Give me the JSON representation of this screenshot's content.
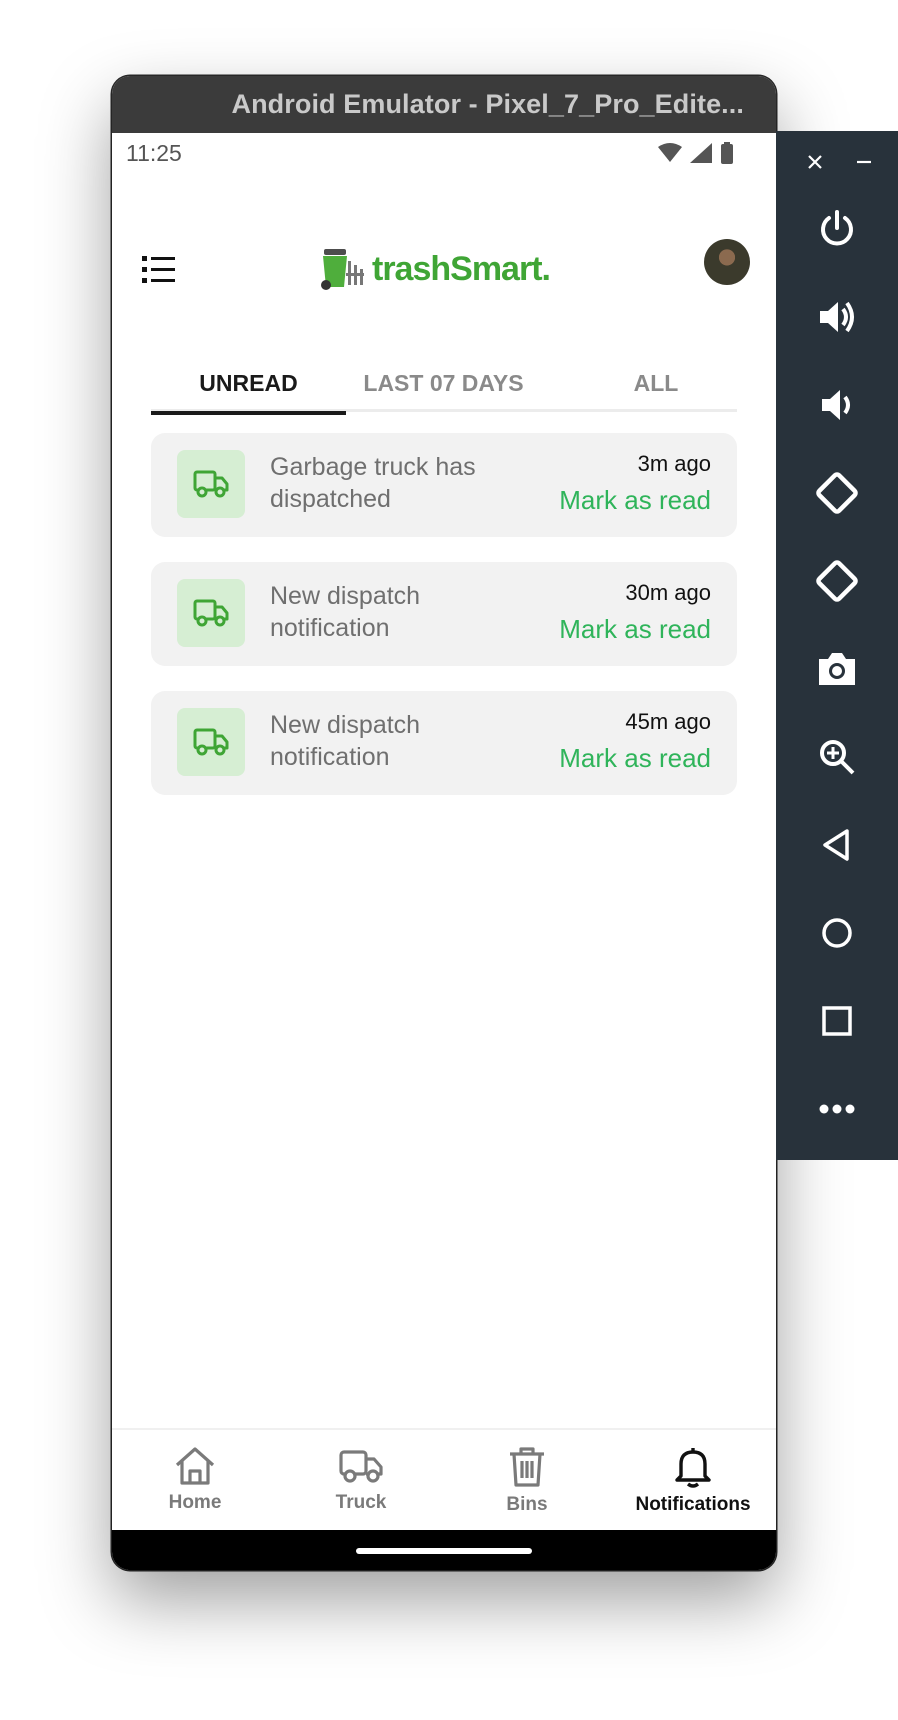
{
  "window": {
    "title": "Android Emulator - Pixel_7_Pro_Edite..."
  },
  "status_bar": {
    "time": "11:25",
    "icons": [
      "wifi-icon",
      "cell-signal-icon",
      "battery-icon"
    ]
  },
  "header": {
    "menu_icon": "list-menu-icon",
    "logo_text": "trashSmart.",
    "avatar": "user-avatar"
  },
  "tabs": [
    {
      "label": "UNREAD",
      "active": true
    },
    {
      "label": "LAST 07 DAYS",
      "active": false
    },
    {
      "label": "ALL",
      "active": false
    }
  ],
  "notifications": [
    {
      "title": "Garbage truck has dispatched",
      "time": "3m ago",
      "action": "Mark as read",
      "icon": "truck-icon"
    },
    {
      "title": "New dispatch notification",
      "time": "30m ago",
      "action": "Mark as read",
      "icon": "truck-icon"
    },
    {
      "title": "New dispatch notification",
      "time": "45m ago",
      "action": "Mark as read",
      "icon": "truck-icon"
    }
  ],
  "bottom_nav": [
    {
      "label": "Home",
      "icon": "home-icon",
      "active": false
    },
    {
      "label": "Truck",
      "icon": "truck-icon",
      "active": false
    },
    {
      "label": "Bins",
      "icon": "trash-bin-icon",
      "active": false
    },
    {
      "label": "Notifications",
      "icon": "bell-icon",
      "active": true
    }
  ],
  "emulator_toolbar": {
    "buttons": [
      "power-icon",
      "volume-up-icon",
      "volume-down-icon",
      "rotate-left-icon",
      "rotate-right-icon",
      "camera-icon",
      "zoom-icon",
      "back-icon",
      "home-circle-icon",
      "overview-icon",
      "more-icon"
    ]
  },
  "colors": {
    "accent_green": "#2fb45a",
    "logo_green": "#3fa535",
    "icon_bg": "#d6eed3",
    "toolbar_bg": "#28323b"
  }
}
